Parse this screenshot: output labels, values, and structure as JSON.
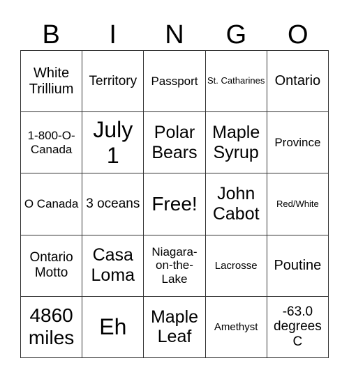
{
  "header": [
    "B",
    "I",
    "N",
    "G",
    "O"
  ],
  "cells": [
    [
      "White Trillium",
      "Territory",
      "Passport",
      "St. Catharines",
      "Ontario"
    ],
    [
      "1-800-O-Canada",
      "July 1",
      "Polar Bears",
      "Maple Syrup",
      "Province"
    ],
    [
      "O Canada",
      "3 oceans",
      "Free!",
      "John Cabot",
      "Red/White"
    ],
    [
      "Ontario Motto",
      "Casa Loma",
      "Niagara-on-the-Lake",
      "Lacrosse",
      "Poutine"
    ],
    [
      "4860 miles",
      "Eh",
      "Maple Leaf",
      "Amethyst",
      "-63.0 degrees C"
    ]
  ]
}
